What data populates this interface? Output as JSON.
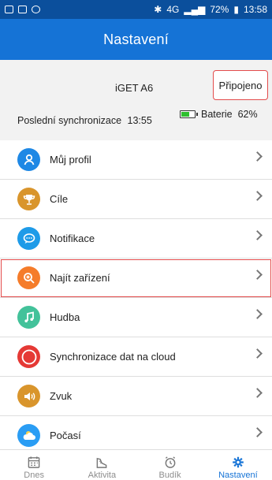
{
  "status_bar": {
    "time": "13:58",
    "battery_percent": "72%",
    "network": "4G"
  },
  "header": {
    "title": "Nastavení"
  },
  "device": {
    "name": "iGET A6",
    "connection_status": "Připojeno",
    "last_sync_label": "Poslední synchronizace",
    "last_sync_time": "13:55",
    "battery_label": "Baterie",
    "battery_value": "62%",
    "battery_level": 0.62
  },
  "menu": [
    {
      "label": "Můj profil",
      "icon": "person-icon",
      "color": "#1e88e5"
    },
    {
      "label": "Cíle",
      "icon": "trophy-icon",
      "color": "#d9952c"
    },
    {
      "label": "Notifikace",
      "icon": "chat-icon",
      "color": "#1e9be8"
    },
    {
      "label": "Najít zařízení",
      "icon": "search-plus-icon",
      "color": "#f57c2a"
    },
    {
      "label": "Hudba",
      "icon": "music-icon",
      "color": "#43c29a"
    },
    {
      "label": "Synchronizace dat na cloud",
      "icon": "cloud-sync-icon",
      "color": "#e53935"
    },
    {
      "label": "Zvuk",
      "icon": "speaker-icon",
      "color": "#d9952c"
    },
    {
      "label": "Počasí",
      "icon": "weather-icon",
      "color": "#2a9df4"
    }
  ],
  "tabs": [
    {
      "label": "Dnes",
      "icon": "calendar-icon"
    },
    {
      "label": "Aktivita",
      "icon": "shoe-icon"
    },
    {
      "label": "Budík",
      "icon": "alarm-icon"
    },
    {
      "label": "Nastavení",
      "icon": "gear-icon",
      "active": true
    }
  ],
  "colors": {
    "header": "#1573d6",
    "status_bar": "#0b4f9c",
    "highlight": "#e34b4b",
    "active_tab": "#1573d6"
  }
}
